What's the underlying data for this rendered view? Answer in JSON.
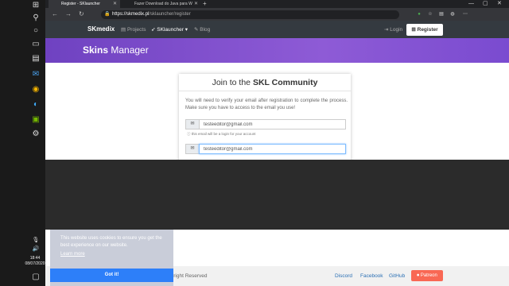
{
  "taskbar": {
    "icons": [
      "windows-logo-icon",
      "search-icon",
      "cortana-icon",
      "task-view-icon",
      "file-explorer-icon",
      "mail-icon",
      "chrome-icon",
      "edge-icon",
      "nvidia-icon",
      "settings-icon"
    ],
    "time": "18:44",
    "date": "08/07/2020"
  },
  "browser": {
    "tabs": [
      {
        "label": "Register - SKlauncher"
      },
      {
        "label": "Fazer Download do Java para W"
      }
    ],
    "url_prefix": "https://",
    "url_host": "skmedix.pl",
    "url_path": "/sklauncher/register"
  },
  "site": {
    "brand": "SKmedix",
    "nav": {
      "projects": "Projects",
      "sklauncher": "SKlauncher",
      "blog": "Blog",
      "login": "Login",
      "register": "Register"
    },
    "hero_bold": "Skins",
    "hero_rest": " Manager",
    "card": {
      "title_prefix": "Join to the ",
      "title_bold": "SKL Community",
      "text": "You will need to verify your email after registration to complete the process. Make sure you have to access to the email you use!",
      "email_value": "testeeditor@gmail.com",
      "email_help": "this email will be a login for your account",
      "confirm_value": "testeeditor@gmail.com"
    },
    "footer": {
      "copyright": "yright Reserved",
      "discord": "Discord",
      "facebook": "Facebook",
      "github": "GitHub",
      "patreon": "Patreon"
    },
    "cookie": {
      "text": "This website uses cookies to ensure you get the best experience on our website.",
      "learn_more": "Learn more",
      "got_it": "Got it!"
    }
  },
  "colors": {
    "hero": "#6f42c1",
    "navbar": "#343a40",
    "patreon": "#f96854",
    "gotit": "#2d7ff9"
  }
}
